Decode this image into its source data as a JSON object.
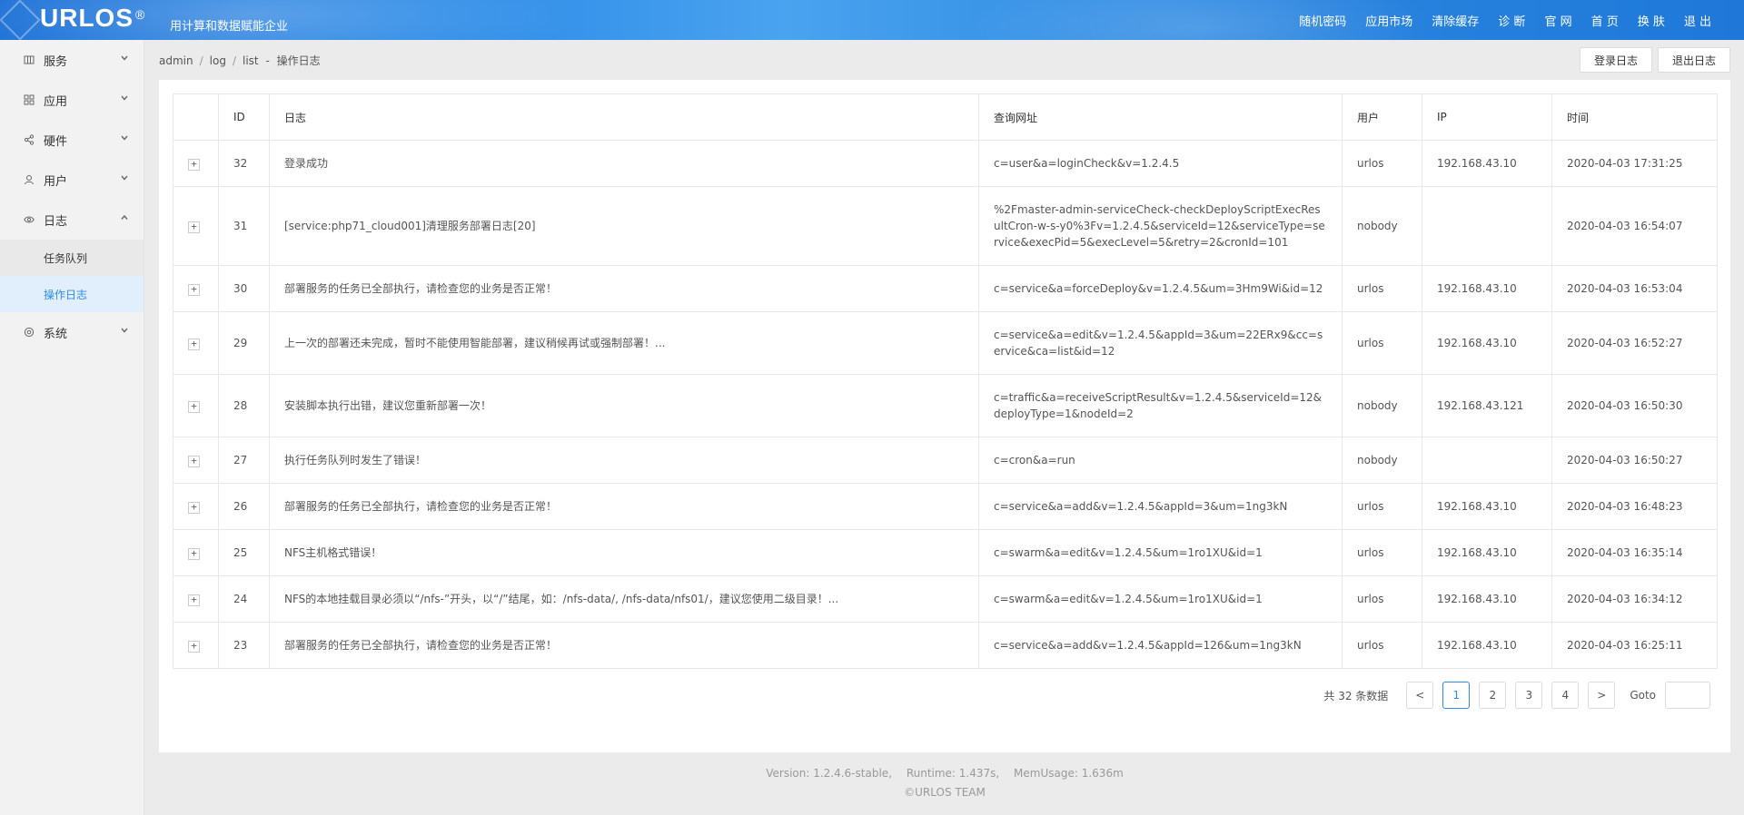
{
  "header": {
    "logo": "URLOS",
    "logo_reg": "®",
    "slogan": "用计算和数据赋能企业",
    "nav": [
      "随机密码",
      "应用市场",
      "清除缓存",
      "诊 断",
      "官 网",
      "首 页",
      "换 肤",
      "退 出"
    ]
  },
  "sidebar": {
    "items": [
      {
        "label": "服务",
        "icon": "server-icon"
      },
      {
        "label": "应用",
        "icon": "grid-icon"
      },
      {
        "label": "硬件",
        "icon": "share-icon"
      },
      {
        "label": "用户",
        "icon": "user-icon"
      },
      {
        "label": "日志",
        "icon": "eye-icon"
      },
      {
        "label": "系统",
        "icon": "gear-icon"
      }
    ],
    "sub_items": [
      "任务队列",
      "操作日志"
    ]
  },
  "breadcrumb": [
    "admin",
    "log",
    "list",
    "操作日志"
  ],
  "breadcrumb_dash": "-",
  "buttons": {
    "login_log": "登录日志",
    "logout_log": "退出日志"
  },
  "table": {
    "columns": [
      "",
      "ID",
      "日志",
      "查询网址",
      "用户",
      "IP",
      "时间"
    ],
    "rows": [
      {
        "id": "32",
        "log": "登录成功",
        "url": "c=user&a=loginCheck&v=1.2.4.5",
        "user": "urlos",
        "ip": "192.168.43.10",
        "time": "2020-04-03 17:31:25"
      },
      {
        "id": "31",
        "log": "[service:php71_cloud001]清理服务部署日志[20]",
        "url": "%2Fmaster-admin-serviceCheck-checkDeployScriptExecResultCron-w-s-y0%3Fv=1.2.4.5&serviceId=12&serviceType=service&execPid=5&execLevel=5&retry=2&cronId=101",
        "user": "nobody",
        "ip": "",
        "time": "2020-04-03 16:54:07"
      },
      {
        "id": "30",
        "log": "部署服务的任务已全部执行，请检查您的业务是否正常！",
        "url": "c=service&a=forceDeploy&v=1.2.4.5&um=3Hm9Wi&id=12",
        "user": "urlos",
        "ip": "192.168.43.10",
        "time": "2020-04-03 16:53:04"
      },
      {
        "id": "29",
        "log": "上一次的部署还未完成，暂时不能使用智能部署，建议稍候再试或强制部署！...",
        "url": "c=service&a=edit&v=1.2.4.5&appId=3&um=22ERx9&cc=service&ca=list&id=12",
        "user": "urlos",
        "ip": "192.168.43.10",
        "time": "2020-04-03 16:52:27"
      },
      {
        "id": "28",
        "log": "安装脚本执行出错，建议您重新部署一次！",
        "url": "c=traffic&a=receiveScriptResult&v=1.2.4.5&serviceId=12&deployType=1&nodeId=2",
        "user": "nobody",
        "ip": "192.168.43.121",
        "time": "2020-04-03 16:50:30"
      },
      {
        "id": "27",
        "log": "执行任务队列时发生了错误！",
        "url": "c=cron&a=run",
        "user": "nobody",
        "ip": "",
        "time": "2020-04-03 16:50:27"
      },
      {
        "id": "26",
        "log": "部署服务的任务已全部执行，请检查您的业务是否正常！",
        "url": "c=service&a=add&v=1.2.4.5&appId=3&um=1ng3kN",
        "user": "urlos",
        "ip": "192.168.43.10",
        "time": "2020-04-03 16:48:23"
      },
      {
        "id": "25",
        "log": "NFS主机格式错误！",
        "url": "c=swarm&a=edit&v=1.2.4.5&um=1ro1XU&id=1",
        "user": "urlos",
        "ip": "192.168.43.10",
        "time": "2020-04-03 16:35:14"
      },
      {
        "id": "24",
        "log": "NFS的本地挂载目录必须以“/nfs-”开头，以“/”结尾，如：/nfs-data/, /nfs-data/nfs01/，建议您使用二级目录！...",
        "url": "c=swarm&a=edit&v=1.2.4.5&um=1ro1XU&id=1",
        "user": "urlos",
        "ip": "192.168.43.10",
        "time": "2020-04-03 16:34:12"
      },
      {
        "id": "23",
        "log": "部署服务的任务已全部执行，请检查您的业务是否正常！",
        "url": "c=service&a=add&v=1.2.4.5&appId=126&um=1ng3kN",
        "user": "urlos",
        "ip": "192.168.43.10",
        "time": "2020-04-03 16:25:11"
      }
    ]
  },
  "pagination": {
    "total": "共 32 条数据",
    "prev": "<",
    "next": ">",
    "pages": [
      "1",
      "2",
      "3",
      "4"
    ],
    "current": "1",
    "goto_label": "Goto",
    "goto_value": ""
  },
  "footer": {
    "version": "Version: 1.2.4.6-stable,",
    "runtime": "Runtime: 1.437s,",
    "mem": "MemUsage: 1.636m",
    "copyright": "©URLOS TEAM"
  }
}
